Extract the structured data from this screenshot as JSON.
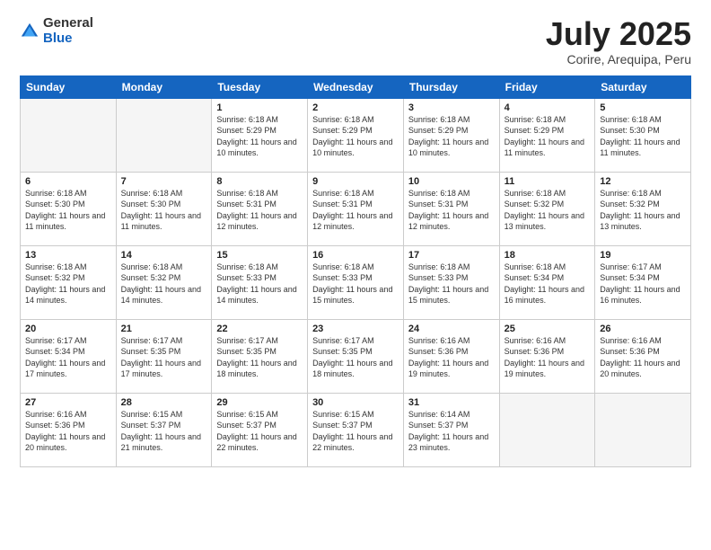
{
  "logo": {
    "general": "General",
    "blue": "Blue"
  },
  "header": {
    "month": "July 2025",
    "location": "Corire, Arequipa, Peru"
  },
  "weekdays": [
    "Sunday",
    "Monday",
    "Tuesday",
    "Wednesday",
    "Thursday",
    "Friday",
    "Saturday"
  ],
  "weeks": [
    [
      {
        "day": "",
        "empty": true
      },
      {
        "day": "",
        "empty": true
      },
      {
        "day": "1",
        "sunrise": "6:18 AM",
        "sunset": "5:29 PM",
        "daylight": "11 hours and 10 minutes."
      },
      {
        "day": "2",
        "sunrise": "6:18 AM",
        "sunset": "5:29 PM",
        "daylight": "11 hours and 10 minutes."
      },
      {
        "day": "3",
        "sunrise": "6:18 AM",
        "sunset": "5:29 PM",
        "daylight": "11 hours and 10 minutes."
      },
      {
        "day": "4",
        "sunrise": "6:18 AM",
        "sunset": "5:29 PM",
        "daylight": "11 hours and 11 minutes."
      },
      {
        "day": "5",
        "sunrise": "6:18 AM",
        "sunset": "5:30 PM",
        "daylight": "11 hours and 11 minutes."
      }
    ],
    [
      {
        "day": "6",
        "sunrise": "6:18 AM",
        "sunset": "5:30 PM",
        "daylight": "11 hours and 11 minutes."
      },
      {
        "day": "7",
        "sunrise": "6:18 AM",
        "sunset": "5:30 PM",
        "daylight": "11 hours and 11 minutes."
      },
      {
        "day": "8",
        "sunrise": "6:18 AM",
        "sunset": "5:31 PM",
        "daylight": "11 hours and 12 minutes."
      },
      {
        "day": "9",
        "sunrise": "6:18 AM",
        "sunset": "5:31 PM",
        "daylight": "11 hours and 12 minutes."
      },
      {
        "day": "10",
        "sunrise": "6:18 AM",
        "sunset": "5:31 PM",
        "daylight": "11 hours and 12 minutes."
      },
      {
        "day": "11",
        "sunrise": "6:18 AM",
        "sunset": "5:32 PM",
        "daylight": "11 hours and 13 minutes."
      },
      {
        "day": "12",
        "sunrise": "6:18 AM",
        "sunset": "5:32 PM",
        "daylight": "11 hours and 13 minutes."
      }
    ],
    [
      {
        "day": "13",
        "sunrise": "6:18 AM",
        "sunset": "5:32 PM",
        "daylight": "11 hours and 14 minutes."
      },
      {
        "day": "14",
        "sunrise": "6:18 AM",
        "sunset": "5:32 PM",
        "daylight": "11 hours and 14 minutes."
      },
      {
        "day": "15",
        "sunrise": "6:18 AM",
        "sunset": "5:33 PM",
        "daylight": "11 hours and 14 minutes."
      },
      {
        "day": "16",
        "sunrise": "6:18 AM",
        "sunset": "5:33 PM",
        "daylight": "11 hours and 15 minutes."
      },
      {
        "day": "17",
        "sunrise": "6:18 AM",
        "sunset": "5:33 PM",
        "daylight": "11 hours and 15 minutes."
      },
      {
        "day": "18",
        "sunrise": "6:18 AM",
        "sunset": "5:34 PM",
        "daylight": "11 hours and 16 minutes."
      },
      {
        "day": "19",
        "sunrise": "6:17 AM",
        "sunset": "5:34 PM",
        "daylight": "11 hours and 16 minutes."
      }
    ],
    [
      {
        "day": "20",
        "sunrise": "6:17 AM",
        "sunset": "5:34 PM",
        "daylight": "11 hours and 17 minutes."
      },
      {
        "day": "21",
        "sunrise": "6:17 AM",
        "sunset": "5:35 PM",
        "daylight": "11 hours and 17 minutes."
      },
      {
        "day": "22",
        "sunrise": "6:17 AM",
        "sunset": "5:35 PM",
        "daylight": "11 hours and 18 minutes."
      },
      {
        "day": "23",
        "sunrise": "6:17 AM",
        "sunset": "5:35 PM",
        "daylight": "11 hours and 18 minutes."
      },
      {
        "day": "24",
        "sunrise": "6:16 AM",
        "sunset": "5:36 PM",
        "daylight": "11 hours and 19 minutes."
      },
      {
        "day": "25",
        "sunrise": "6:16 AM",
        "sunset": "5:36 PM",
        "daylight": "11 hours and 19 minutes."
      },
      {
        "day": "26",
        "sunrise": "6:16 AM",
        "sunset": "5:36 PM",
        "daylight": "11 hours and 20 minutes."
      }
    ],
    [
      {
        "day": "27",
        "sunrise": "6:16 AM",
        "sunset": "5:36 PM",
        "daylight": "11 hours and 20 minutes."
      },
      {
        "day": "28",
        "sunrise": "6:15 AM",
        "sunset": "5:37 PM",
        "daylight": "11 hours and 21 minutes."
      },
      {
        "day": "29",
        "sunrise": "6:15 AM",
        "sunset": "5:37 PM",
        "daylight": "11 hours and 22 minutes."
      },
      {
        "day": "30",
        "sunrise": "6:15 AM",
        "sunset": "5:37 PM",
        "daylight": "11 hours and 22 minutes."
      },
      {
        "day": "31",
        "sunrise": "6:14 AM",
        "sunset": "5:37 PM",
        "daylight": "11 hours and 23 minutes."
      },
      {
        "day": "",
        "empty": true
      },
      {
        "day": "",
        "empty": true
      }
    ]
  ]
}
